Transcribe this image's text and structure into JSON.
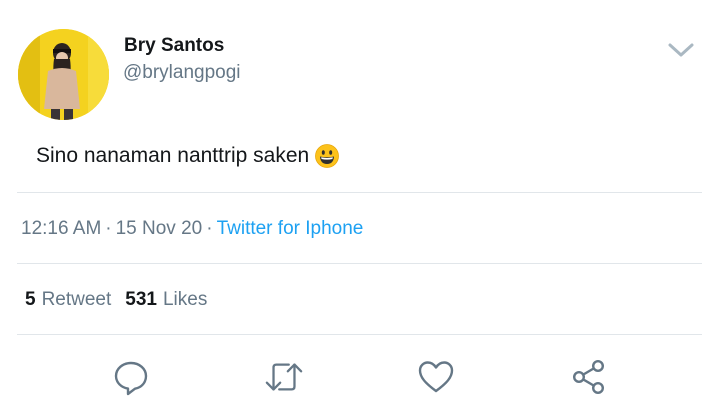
{
  "user": {
    "display_name": "Bry Santos",
    "handle": "@brylangpogi",
    "avatar_icon": "profile-photo"
  },
  "tweet": {
    "text": "Sino nanaman nanttrip saken",
    "emoji_icon": "grinning-face-emoji"
  },
  "meta": {
    "time": "12:16 AM",
    "separator": "·",
    "date": "15 Nov 20",
    "source": "Twitter for Iphone"
  },
  "stats": {
    "retweets_count": "5",
    "retweets_label": "Retweet",
    "likes_count": "531",
    "likes_label": "Likes"
  },
  "actions": [
    "reply-icon",
    "retweet-icon",
    "like-icon",
    "share-icon"
  ],
  "colors": {
    "text": "#14171a",
    "secondary": "#657786",
    "link": "#1da1f2",
    "divider": "#e1e6ea",
    "icon": "#657786"
  }
}
